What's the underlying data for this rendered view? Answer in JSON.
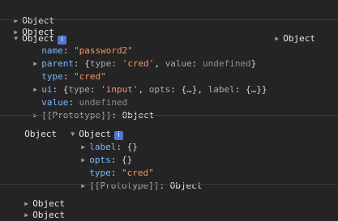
{
  "entries": {
    "e1": {
      "left": "Object",
      "right": "Object"
    },
    "e2": {
      "header": "Object",
      "info_badge": "i",
      "right": "Object",
      "name_key": "name",
      "name_value": "\"password2\"",
      "parent_key": "parent",
      "parent_open": "{",
      "parent_type_key": "type",
      "parent_type_value": "'cred'",
      "parent_value_key": "value",
      "parent_value_value": "undefined",
      "parent_close": "}",
      "type_key": "type",
      "type_value": "\"cred\"",
      "ui_key": "ui",
      "ui_open": "{",
      "ui_type_key": "type",
      "ui_type_value": "'input'",
      "ui_opts_key": "opts",
      "ui_opts_value": "{…}",
      "ui_label_key": "label",
      "ui_label_value": "{…}",
      "ui_close": "}",
      "value_key": "value",
      "value_value": "undefined",
      "proto_key": "[[Prototype]]",
      "proto_value": "Object"
    },
    "e3": {
      "left": "Object",
      "header": "Object",
      "info_badge": "i",
      "label_key": "label",
      "label_value": "{}",
      "opts_key": "opts",
      "opts_value": "{}",
      "type_key": "type",
      "type_value": "\"cred\"",
      "proto_key": "[[Prototype]]",
      "proto_value": "Object"
    },
    "e4": {
      "left": "Object",
      "right": "Object"
    }
  }
}
